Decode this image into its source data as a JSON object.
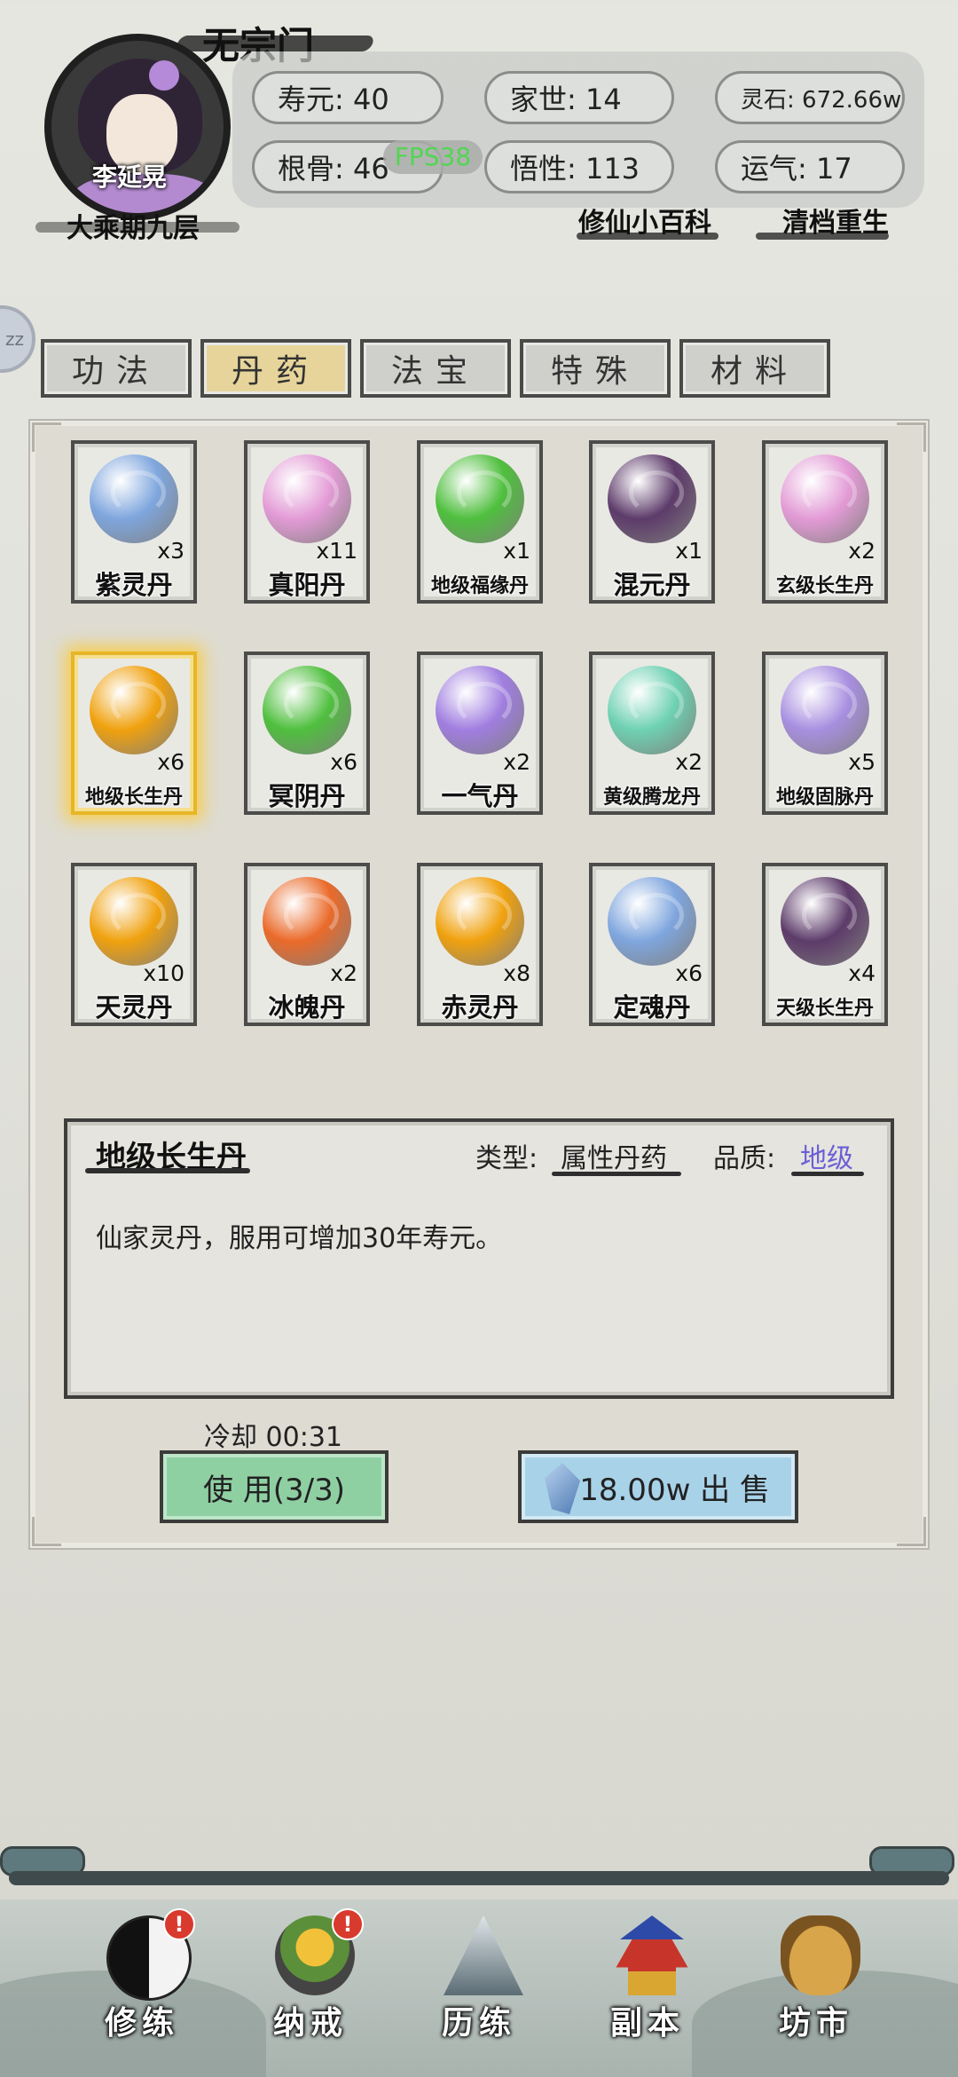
{
  "header": {
    "sect_name": "无宗门",
    "character_name": "李延晃",
    "realm": "大乘期九层",
    "fps": "FPS38",
    "stats": {
      "lifespan": "寿元: 40",
      "family": "家世: 14",
      "spirit_stones": "灵石: 672.66w",
      "root_bone": "根骨: 46",
      "comprehension": "悟性: 113",
      "luck": "运气: 17"
    },
    "wiki_link": "修仙小百科",
    "reset_link": "清档重生"
  },
  "side_tab_label": "zz",
  "tabs": [
    {
      "label": "功法",
      "active": false
    },
    {
      "label": "丹药",
      "active": true
    },
    {
      "label": "法宝",
      "active": false
    },
    {
      "label": "特殊",
      "active": false
    },
    {
      "label": "材料",
      "active": false
    }
  ],
  "items": [
    {
      "name": "紫灵丹",
      "qty": "x3",
      "color": "#7fa6de"
    },
    {
      "name": "真阳丹",
      "qty": "x11",
      "color": "#e39bd6"
    },
    {
      "name": "地级福缘丹",
      "qty": "x1",
      "color": "#4fbf3e"
    },
    {
      "name": "混元丹",
      "qty": "x1",
      "color": "#5d3b6a"
    },
    {
      "name": "玄级长生丹",
      "qty": "x2",
      "color": "#e39bd6"
    },
    {
      "name": "地级长生丹",
      "qty": "x6",
      "color": "#f0a10e",
      "selected": true
    },
    {
      "name": "冥阴丹",
      "qty": "x6",
      "color": "#4fbf3e"
    },
    {
      "name": "一气丹",
      "qty": "x2",
      "color": "#a07ee0"
    },
    {
      "name": "黄级腾龙丹",
      "qty": "x2",
      "color": "#6ed1b2"
    },
    {
      "name": "地级固脉丹",
      "qty": "x5",
      "color": "#a88fe0"
    },
    {
      "name": "天灵丹",
      "qty": "x10",
      "color": "#f0a10e"
    },
    {
      "name": "冰魄丹",
      "qty": "x2",
      "color": "#ea6a2a"
    },
    {
      "name": "赤灵丹",
      "qty": "x8",
      "color": "#f0a10e"
    },
    {
      "name": "定魂丹",
      "qty": "x6",
      "color": "#7fa6de"
    },
    {
      "name": "天级长生丹",
      "qty": "x4",
      "color": "#5d3b6a"
    }
  ],
  "detail": {
    "title": "地级长生丹",
    "type_label": "类型:",
    "type_value": "属性丹药",
    "quality_label": "品质:",
    "quality_value": "地级",
    "quality_color": "#6b5fd6",
    "description": "仙家灵丹，服用可增加30年寿元。"
  },
  "cooldown": "冷却 00:31",
  "use_button": "使 用(3/3)",
  "sell_button": "18.00w 出 售",
  "nav": [
    {
      "label": "修练",
      "icon": "yin-yang-icon",
      "badge": "!"
    },
    {
      "label": "纳戒",
      "icon": "ring-icon",
      "badge": "!"
    },
    {
      "label": "历练",
      "icon": "mountain-icon"
    },
    {
      "label": "副本",
      "icon": "pagoda-icon"
    },
    {
      "label": "坊市",
      "icon": "cauldron-icon"
    }
  ]
}
